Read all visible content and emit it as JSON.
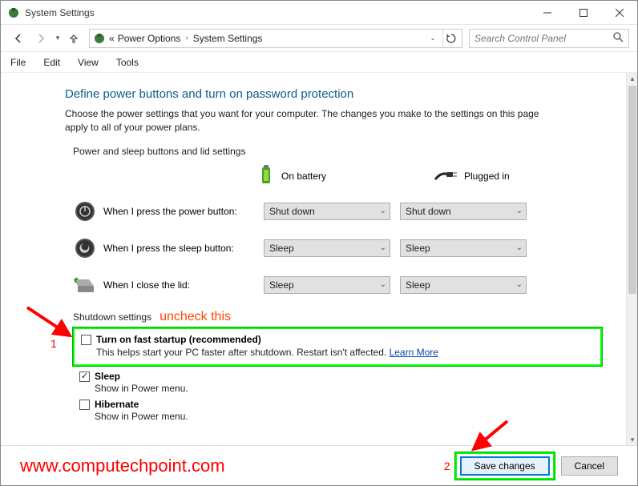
{
  "window": {
    "title": "System Settings"
  },
  "breadcrumb": {
    "prefix": "«",
    "a": "Power Options",
    "b": "System Settings"
  },
  "search": {
    "placeholder": "Search Control Panel"
  },
  "menu": {
    "file": "File",
    "edit": "Edit",
    "view": "View",
    "tools": "Tools"
  },
  "main": {
    "heading": "Define power buttons and turn on password protection",
    "intro": "Choose the power settings that you want for your computer. The changes you make to the settings on this page apply to all of your power plans.",
    "section1_label": "Power and sleep buttons and lid settings",
    "col_battery": "On battery",
    "col_plugged": "Plugged in",
    "row_power_label": "When I press the power button:",
    "row_sleep_label": "When I press the sleep button:",
    "row_lid_label": "When I close the lid:",
    "sel_power_bat": "Shut down",
    "sel_power_plug": "Shut down",
    "sel_sleep_bat": "Sleep",
    "sel_sleep_plug": "Sleep",
    "sel_lid_bat": "Sleep",
    "sel_lid_plug": "Sleep",
    "shutdown_label": "Shutdown settings",
    "annot_uncheck": "uncheck this",
    "fast_startup_label": "Turn on fast startup (recommended)",
    "fast_startup_desc": "This helps start your PC faster after shutdown. Restart isn't affected. ",
    "learn_more": "Learn More",
    "sleep_label": "Sleep",
    "sleep_desc": "Show in Power menu.",
    "hibernate_label": "Hibernate",
    "hibernate_desc": "Show in Power menu."
  },
  "footer": {
    "watermark": "www.computechpoint.com",
    "save": "Save changes",
    "cancel": "Cancel"
  },
  "annotations": {
    "num1": "1",
    "num2": "2"
  }
}
